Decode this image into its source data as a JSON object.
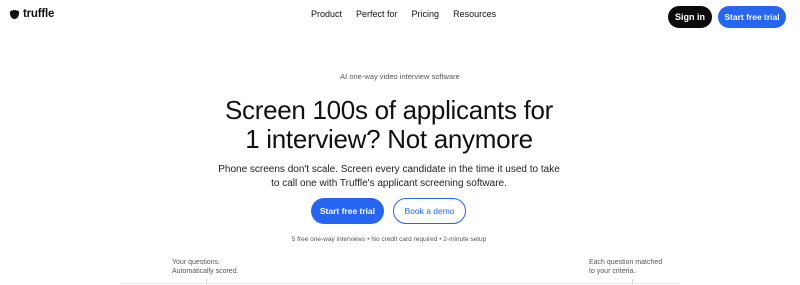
{
  "nav": {
    "logo_text": "truffle",
    "links": [
      "Product",
      "Perfect for",
      "Pricing",
      "Resources"
    ],
    "sign_in": "Sign in",
    "start_trial": "Start free trial"
  },
  "hero": {
    "eyebrow": "AI one-way video interview software",
    "headline_line1": "Screen 100s of applicants for",
    "headline_line2": "1 interview? Not anymore",
    "subtext_line1": "Phone screens don't scale. Screen every candidate in the time it used to take",
    "subtext_line2": "to call one with Truffle's applicant screening software.",
    "cta_primary": "Start free trial",
    "cta_secondary": "Book a demo",
    "fineprint": "5 free one-way interviews • No credit card required • 2-minute setup"
  },
  "annotations": {
    "left_line1": "Your questions.",
    "left_line2": "Automatically scored.",
    "right_line1": "Each question matched",
    "right_line2": "to your criteria."
  },
  "colors": {
    "accent": "#2565f0",
    "dark_button": "#0b0b0b"
  }
}
